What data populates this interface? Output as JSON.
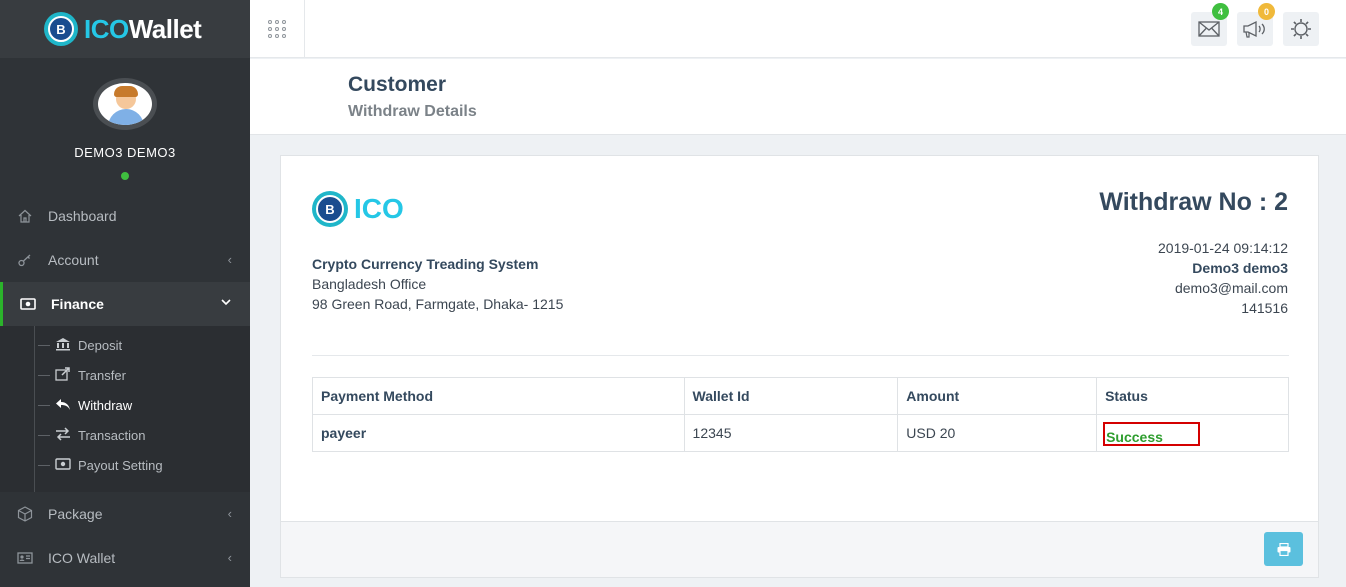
{
  "brand": {
    "prefix": "ICO",
    "suffix": "Wallet",
    "logo_glyph": "B"
  },
  "user": {
    "name": "DEMO3 DEMO3",
    "status_color": "#3fbf3f"
  },
  "sidebar": {
    "items": [
      {
        "label": "Dashboard",
        "icon": "home-icon"
      },
      {
        "label": "Account",
        "icon": "key-icon"
      },
      {
        "label": "Finance",
        "icon": "money-icon"
      },
      {
        "label": "Package",
        "icon": "cube-icon"
      },
      {
        "label": "ICO Wallet",
        "icon": "id-card-icon"
      }
    ],
    "finance_submenu": [
      {
        "label": "Deposit",
        "icon": "bank-icon"
      },
      {
        "label": "Transfer",
        "icon": "share-icon"
      },
      {
        "label": "Withdraw",
        "icon": "reply-icon"
      },
      {
        "label": "Transaction",
        "icon": "exchange-icon"
      },
      {
        "label": "Payout Setting",
        "icon": "money-icon"
      }
    ]
  },
  "topbar": {
    "mail_badge": "4",
    "mail_badge_color": "#3fbf3f",
    "announce_badge": "0",
    "announce_badge_color": "#f0b93a"
  },
  "header": {
    "title": "Customer",
    "subtitle": "Withdraw Details"
  },
  "invoice": {
    "logo_text": "ICO",
    "company_name": "Crypto Currency Treading System",
    "office": "Bangladesh Office",
    "address": "98 Green Road, Farmgate, Dhaka- 1215",
    "withdraw_label": "Withdraw No : 2",
    "datetime": "2019-01-24 09:14:12",
    "customer_name": "Demo3 demo3",
    "email": "demo3@mail.com",
    "customer_id": "141516"
  },
  "table": {
    "headers": [
      "Payment Method",
      "Wallet Id",
      "Amount",
      "Status"
    ],
    "row": {
      "method": "payeer",
      "wallet_id": "12345",
      "amount": "USD 20",
      "status": "Success"
    }
  },
  "colors": {
    "accent": "#25c7e6",
    "success": "#2f9e2f",
    "print_button": "#5bc0de",
    "active_border": "#2bb32b"
  }
}
